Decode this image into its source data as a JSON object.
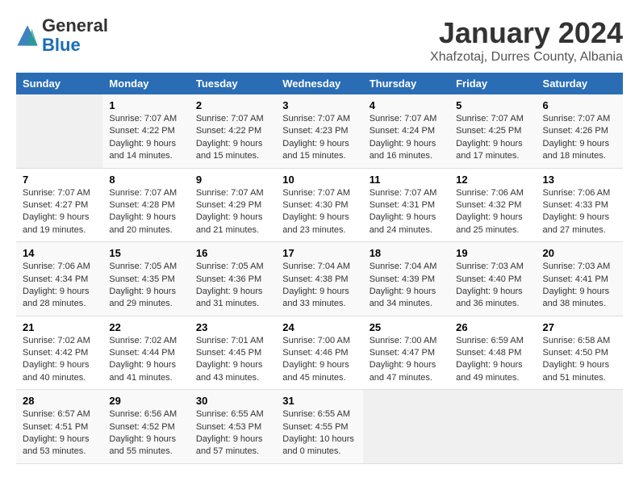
{
  "logo": {
    "general": "General",
    "blue": "Blue"
  },
  "title": "January 2024",
  "subtitle": "Xhafzotaj, Durres County, Albania",
  "headers": [
    "Sunday",
    "Monday",
    "Tuesday",
    "Wednesday",
    "Thursday",
    "Friday",
    "Saturday"
  ],
  "weeks": [
    [
      {
        "day": "",
        "info": ""
      },
      {
        "day": "1",
        "info": "Sunrise: 7:07 AM\nSunset: 4:22 PM\nDaylight: 9 hours\nand 14 minutes."
      },
      {
        "day": "2",
        "info": "Sunrise: 7:07 AM\nSunset: 4:22 PM\nDaylight: 9 hours\nand 15 minutes."
      },
      {
        "day": "3",
        "info": "Sunrise: 7:07 AM\nSunset: 4:23 PM\nDaylight: 9 hours\nand 15 minutes."
      },
      {
        "day": "4",
        "info": "Sunrise: 7:07 AM\nSunset: 4:24 PM\nDaylight: 9 hours\nand 16 minutes."
      },
      {
        "day": "5",
        "info": "Sunrise: 7:07 AM\nSunset: 4:25 PM\nDaylight: 9 hours\nand 17 minutes."
      },
      {
        "day": "6",
        "info": "Sunrise: 7:07 AM\nSunset: 4:26 PM\nDaylight: 9 hours\nand 18 minutes."
      }
    ],
    [
      {
        "day": "7",
        "info": "Sunrise: 7:07 AM\nSunset: 4:27 PM\nDaylight: 9 hours\nand 19 minutes."
      },
      {
        "day": "8",
        "info": "Sunrise: 7:07 AM\nSunset: 4:28 PM\nDaylight: 9 hours\nand 20 minutes."
      },
      {
        "day": "9",
        "info": "Sunrise: 7:07 AM\nSunset: 4:29 PM\nDaylight: 9 hours\nand 21 minutes."
      },
      {
        "day": "10",
        "info": "Sunrise: 7:07 AM\nSunset: 4:30 PM\nDaylight: 9 hours\nand 23 minutes."
      },
      {
        "day": "11",
        "info": "Sunrise: 7:07 AM\nSunset: 4:31 PM\nDaylight: 9 hours\nand 24 minutes."
      },
      {
        "day": "12",
        "info": "Sunrise: 7:06 AM\nSunset: 4:32 PM\nDaylight: 9 hours\nand 25 minutes."
      },
      {
        "day": "13",
        "info": "Sunrise: 7:06 AM\nSunset: 4:33 PM\nDaylight: 9 hours\nand 27 minutes."
      }
    ],
    [
      {
        "day": "14",
        "info": "Sunrise: 7:06 AM\nSunset: 4:34 PM\nDaylight: 9 hours\nand 28 minutes."
      },
      {
        "day": "15",
        "info": "Sunrise: 7:05 AM\nSunset: 4:35 PM\nDaylight: 9 hours\nand 29 minutes."
      },
      {
        "day": "16",
        "info": "Sunrise: 7:05 AM\nSunset: 4:36 PM\nDaylight: 9 hours\nand 31 minutes."
      },
      {
        "day": "17",
        "info": "Sunrise: 7:04 AM\nSunset: 4:38 PM\nDaylight: 9 hours\nand 33 minutes."
      },
      {
        "day": "18",
        "info": "Sunrise: 7:04 AM\nSunset: 4:39 PM\nDaylight: 9 hours\nand 34 minutes."
      },
      {
        "day": "19",
        "info": "Sunrise: 7:03 AM\nSunset: 4:40 PM\nDaylight: 9 hours\nand 36 minutes."
      },
      {
        "day": "20",
        "info": "Sunrise: 7:03 AM\nSunset: 4:41 PM\nDaylight: 9 hours\nand 38 minutes."
      }
    ],
    [
      {
        "day": "21",
        "info": "Sunrise: 7:02 AM\nSunset: 4:42 PM\nDaylight: 9 hours\nand 40 minutes."
      },
      {
        "day": "22",
        "info": "Sunrise: 7:02 AM\nSunset: 4:44 PM\nDaylight: 9 hours\nand 41 minutes."
      },
      {
        "day": "23",
        "info": "Sunrise: 7:01 AM\nSunset: 4:45 PM\nDaylight: 9 hours\nand 43 minutes."
      },
      {
        "day": "24",
        "info": "Sunrise: 7:00 AM\nSunset: 4:46 PM\nDaylight: 9 hours\nand 45 minutes."
      },
      {
        "day": "25",
        "info": "Sunrise: 7:00 AM\nSunset: 4:47 PM\nDaylight: 9 hours\nand 47 minutes."
      },
      {
        "day": "26",
        "info": "Sunrise: 6:59 AM\nSunset: 4:48 PM\nDaylight: 9 hours\nand 49 minutes."
      },
      {
        "day": "27",
        "info": "Sunrise: 6:58 AM\nSunset: 4:50 PM\nDaylight: 9 hours\nand 51 minutes."
      }
    ],
    [
      {
        "day": "28",
        "info": "Sunrise: 6:57 AM\nSunset: 4:51 PM\nDaylight: 9 hours\nand 53 minutes."
      },
      {
        "day": "29",
        "info": "Sunrise: 6:56 AM\nSunset: 4:52 PM\nDaylight: 9 hours\nand 55 minutes."
      },
      {
        "day": "30",
        "info": "Sunrise: 6:55 AM\nSunset: 4:53 PM\nDaylight: 9 hours\nand 57 minutes."
      },
      {
        "day": "31",
        "info": "Sunrise: 6:55 AM\nSunset: 4:55 PM\nDaylight: 10 hours\nand 0 minutes."
      },
      {
        "day": "",
        "info": ""
      },
      {
        "day": "",
        "info": ""
      },
      {
        "day": "",
        "info": ""
      }
    ]
  ]
}
